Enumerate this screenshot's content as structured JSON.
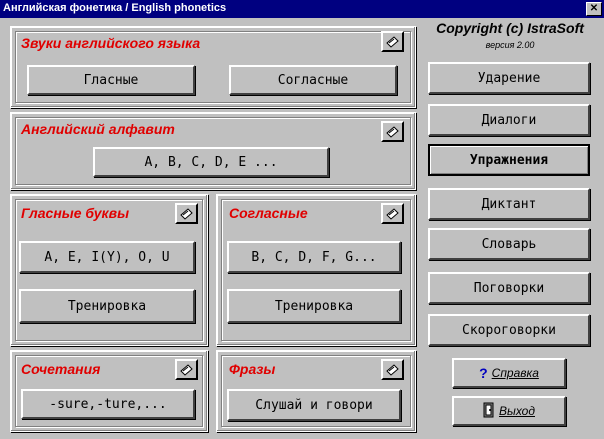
{
  "window": {
    "title": "Английская фонетика / English phonetics",
    "close_glyph": "✕"
  },
  "panels": {
    "sounds": {
      "title": "Звуки английского языка",
      "buttons": [
        "Гласные",
        "Согласные"
      ]
    },
    "alphabet": {
      "title": "Английский алфавит",
      "button": "A, B, C, D, E ..."
    },
    "vowel_letters": {
      "title": "Гласные буквы",
      "button1": "A, E, I(Y), O, U",
      "button2": "Тренировка"
    },
    "consonants": {
      "title": "Согласные",
      "button1": "B, C, D, F, G...",
      "button2": "Тренировка"
    },
    "combinations": {
      "title": "Сочетания",
      "button": "-sure,-ture,..."
    },
    "phrases": {
      "title": "Фразы",
      "button": "Слушай и говори"
    }
  },
  "sidebar": {
    "copyright": "Copyright (c) IstraSoft",
    "version": "версия 2.00",
    "items": [
      {
        "label": "Ударение",
        "active": false
      },
      {
        "label": "Диалоги",
        "active": false
      },
      {
        "label": "Упражнения",
        "active": true
      },
      {
        "label": "Диктант",
        "active": false
      },
      {
        "label": "Словарь",
        "active": false
      },
      {
        "label": "Поговорки",
        "active": false
      },
      {
        "label": "Скороговорки",
        "active": false
      }
    ],
    "help_label": "Справка",
    "help_icon": "?",
    "exit_label": "Выход",
    "exit_icon": "door-icon"
  },
  "colors": {
    "title_bar": "#000080",
    "panel_title": "#e00000",
    "face": "#c0c0c0"
  }
}
